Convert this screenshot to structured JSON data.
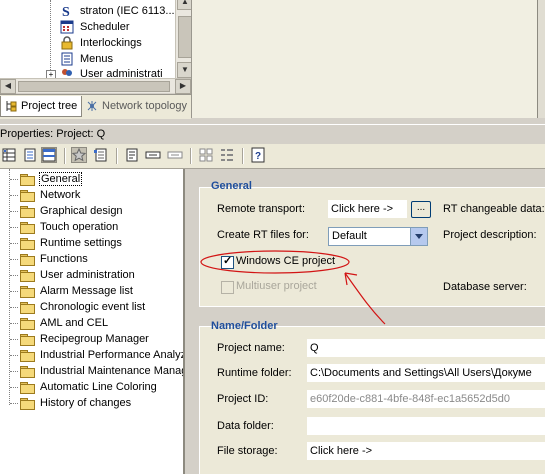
{
  "top_tree": {
    "items": [
      {
        "label": "straton (IEC 6113...",
        "icon": "straton-icon"
      },
      {
        "label": "Scheduler",
        "icon": "calendar-icon"
      },
      {
        "label": "Interlockings",
        "icon": "lock-icon"
      },
      {
        "label": "Menus",
        "icon": "menu-icon"
      },
      {
        "label": "User administrati",
        "icon": "users-icon"
      }
    ]
  },
  "tabs": [
    {
      "label": "Project tree",
      "active": true
    },
    {
      "label": "Network topology",
      "active": false
    }
  ],
  "properties": {
    "header": "Properties: Project: Q"
  },
  "left_tree": {
    "items": [
      {
        "label": "General",
        "selected": true
      },
      {
        "label": "Network"
      },
      {
        "label": "Graphical design"
      },
      {
        "label": "Touch operation"
      },
      {
        "label": "Runtime settings"
      },
      {
        "label": "Functions"
      },
      {
        "label": "User administration"
      },
      {
        "label": "Alarm Message list"
      },
      {
        "label": "Chronologic event list"
      },
      {
        "label": "AML and CEL"
      },
      {
        "label": "Recipegroup Manager"
      },
      {
        "label": "Industrial Performance Analyz"
      },
      {
        "label": "Industrial Maintenance Manag"
      },
      {
        "label": "Automatic Line Coloring"
      },
      {
        "label": "History of changes"
      }
    ]
  },
  "general": {
    "title": "General",
    "remote_transport_label": "Remote transport:",
    "remote_transport_value": "Click here ->",
    "browse_label": "...",
    "rt_changeable_label": "RT changeable data:",
    "create_rt_label": "Create RT files for:",
    "create_rt_value": "Default",
    "project_description_label": "Project description:",
    "windows_ce_label": "Windows CE project",
    "windows_ce_checked": true,
    "multiuser_label": "Multiuser project",
    "multiuser_checked": false,
    "database_server_label": "Database server:"
  },
  "name_folder": {
    "title": "Name/Folder",
    "project_name_label": "Project name:",
    "project_name_value": "Q",
    "runtime_folder_label": "Runtime folder:",
    "runtime_folder_value": "C:\\Documents and Settings\\All Users\\Докуме",
    "project_id_label": "Project ID:",
    "project_id_value": "e60f20de-c881-4bfe-848f-ec1a5652d5d0",
    "data_folder_label": "Data folder:",
    "data_folder_value": "",
    "file_storage_label": "File storage:",
    "file_storage_value": "Click here ->"
  },
  "colors": {
    "annotation": "#d21414",
    "group_title": "#1f4e9c"
  }
}
